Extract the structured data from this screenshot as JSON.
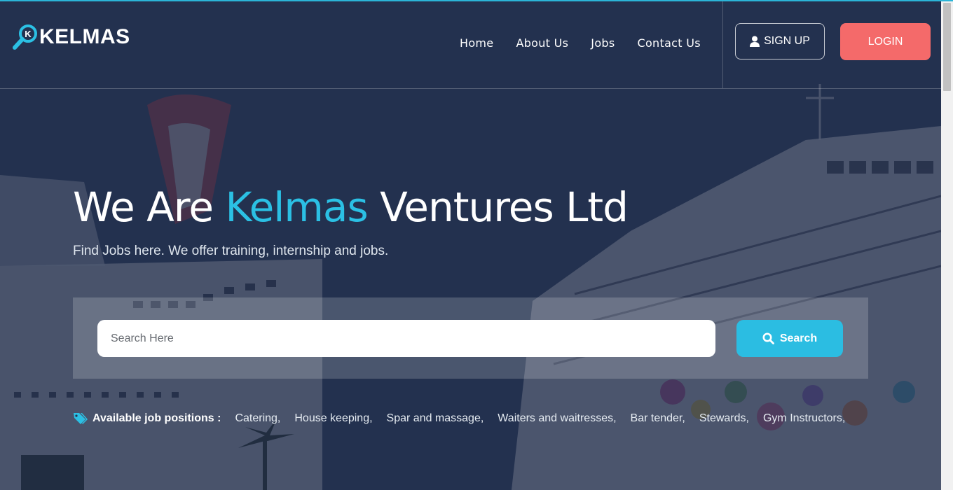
{
  "brand": {
    "name": "KELMAS",
    "logo_letter": "K",
    "accent_color": "#2bc0e4"
  },
  "nav": {
    "items": [
      {
        "label": "Home"
      },
      {
        "label": "About Us"
      },
      {
        "label": "Jobs"
      },
      {
        "label": "Contact Us"
      }
    ],
    "signup_label": "SIGN UP",
    "signup_icon": "user-icon",
    "login_label": "LOGIN",
    "login_color": "#f46a6a"
  },
  "hero": {
    "title_prefix": "We Are",
    "title_accent": "Kelmas",
    "title_suffix": "Ventures Ltd",
    "subtitle": "Find Jobs here. We offer training, internship and jobs."
  },
  "search": {
    "placeholder": "Search Here",
    "value": "",
    "button_label": "Search",
    "button_icon": "search-icon",
    "button_color": "#2bbde2"
  },
  "positions": {
    "label": "Available job positions :",
    "icon": "tags-icon",
    "items": [
      "Catering,",
      "House keeping,",
      "Spar and massage,",
      "Waiters and waitresses,",
      "Bar tender,",
      "Stewards,",
      "Gym Instructors,"
    ]
  }
}
